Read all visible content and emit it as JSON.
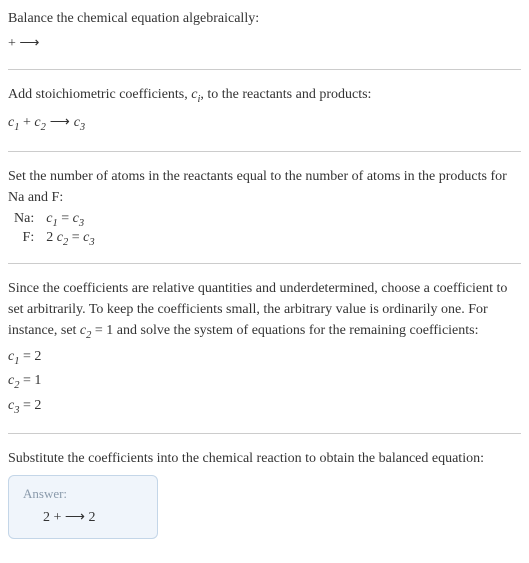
{
  "section1": {
    "line1": "Balance the chemical equation algebraically:",
    "line2_pre": " + ",
    "line2_arrow": "⟶"
  },
  "section2": {
    "line1_pre": "Add stoichiometric coefficients, ",
    "line1_ci_c": "c",
    "line1_ci_i": "i",
    "line1_post": ", to the reactants and products:",
    "eq_c1": "c",
    "eq_c1_sub": "1",
    "eq_plus": " + ",
    "eq_c2": "c",
    "eq_c2_sub": "2",
    "eq_arrow": " ⟶ ",
    "eq_c3": "c",
    "eq_c3_sub": "3"
  },
  "section3": {
    "line1": "Set the number of atoms in the reactants equal to the number of atoms in the products for Na and F:",
    "row1_label": "Na: ",
    "row1_c1": "c",
    "row1_c1_sub": "1",
    "row1_eq": " = ",
    "row1_c3": "c",
    "row1_c3_sub": "3",
    "row2_label": "F: ",
    "row2_coef": "2 ",
    "row2_c2": "c",
    "row2_c2_sub": "2",
    "row2_eq": " = ",
    "row2_c3": "c",
    "row2_c3_sub": "3"
  },
  "section4": {
    "line1_pre": "Since the coefficients are relative quantities and underdetermined, choose a coefficient to set arbitrarily. To keep the coefficients small, the arbitrary value is ordinarily one. For instance, set ",
    "line1_c2": "c",
    "line1_c2_sub": "2",
    "line1_post": " = 1 and solve the system of equations for the remaining coefficients:",
    "eq1_c": "c",
    "eq1_sub": "1",
    "eq1_val": " = 2",
    "eq2_c": "c",
    "eq2_sub": "2",
    "eq2_val": " = 1",
    "eq3_c": "c",
    "eq3_sub": "3",
    "eq3_val": " = 2"
  },
  "section5": {
    "line1": "Substitute the coefficients into the chemical reaction to obtain the balanced equation:",
    "answer_label": "Answer:",
    "answer_eq_pre": "2  +  ",
    "answer_eq_arrow": "⟶",
    "answer_eq_post": "  2"
  }
}
